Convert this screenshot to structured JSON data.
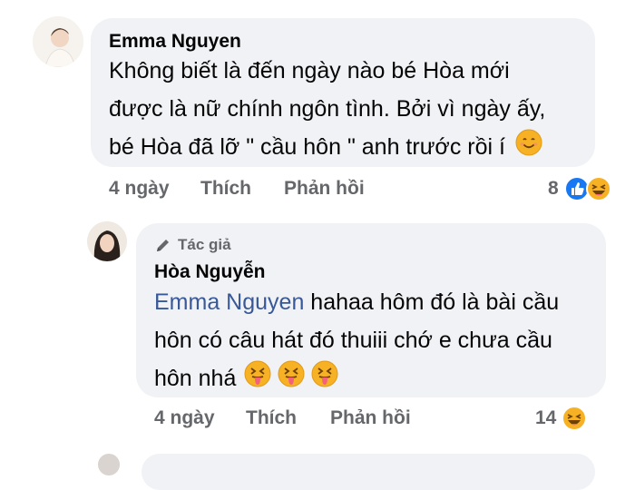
{
  "comment1": {
    "author": "Emma Nguyen",
    "text_lines": [
      "Không biết là đến ngày nào bé Hòa mới",
      "được là nữ chính ngôn tình. Bởi vì ngày ấy,",
      "bé Hòa đã lỡ \" cầu hôn \" anh trước rồi í"
    ],
    "time": "4 ngày",
    "like_label": "Thích",
    "reply_label": "Phản hồi",
    "reaction_count": "8",
    "reaction_icons": [
      "like-icon",
      "haha-icon"
    ],
    "inline_emoji": "smile-emoji"
  },
  "comment2": {
    "author_tag": "Tác giả",
    "author": "Hòa Nguyễn",
    "mention": "Emma Nguyen",
    "text_rest_line1": " hahaa hôm đó là bài cầu",
    "text_line2": "hôn có câu hát đó thuiii chớ e chưa cầu",
    "text_line3": "hôn nhá",
    "inline_emojis": [
      "squint-tongue-emoji",
      "squint-tongue-emoji",
      "squint-tongue-emoji"
    ],
    "time": "4 ngày",
    "like_label": "Thích",
    "reply_label": "Phản hồi",
    "reaction_count": "14",
    "reaction_icons": [
      "haha-icon"
    ]
  },
  "colors": {
    "bubble_bg": "#f0f2f5",
    "mention": "#385898",
    "action_text": "#65676b",
    "like_blue": "#1877f2",
    "emoji_yellow": "#f7b125"
  }
}
